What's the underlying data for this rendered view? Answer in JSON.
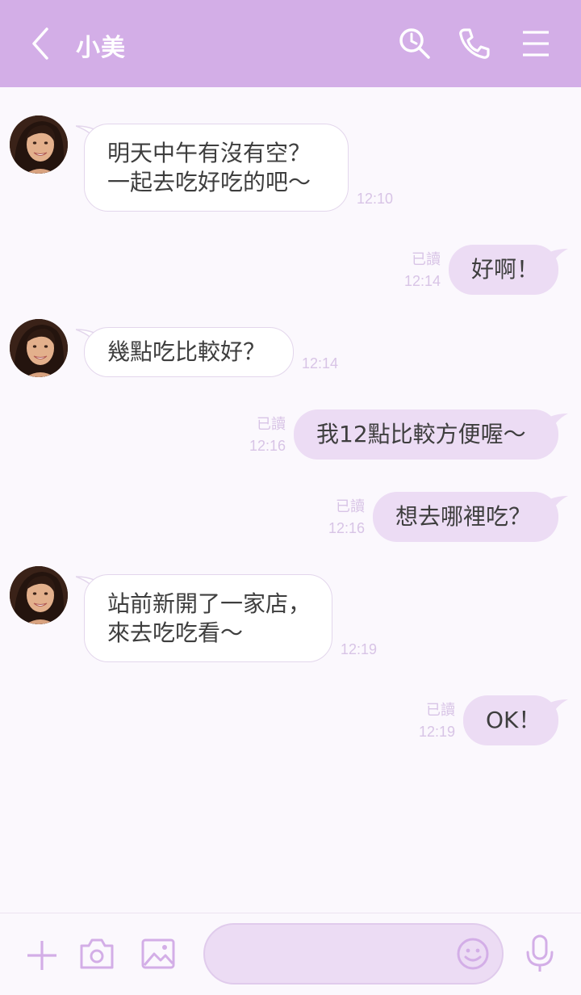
{
  "header": {
    "title": "小美",
    "icons": [
      "back-icon",
      "search-icon",
      "phone-icon",
      "menu-icon"
    ]
  },
  "colors": {
    "header_bg": "#d3aee7",
    "outgoing_bubble": "#ecdcf4",
    "incoming_bubble": "#ffffff",
    "meta_text": "#d8c4e6",
    "icon_accent": "#d3aee7"
  },
  "messages": [
    {
      "dir": "in",
      "lines": [
        "明天中午有沒有空？",
        "一起去吃好吃的吧〜"
      ],
      "time": "12:10"
    },
    {
      "dir": "out",
      "lines": [
        "好啊！"
      ],
      "read": "已讀",
      "time": "12:14"
    },
    {
      "dir": "in",
      "lines": [
        "幾點吃比較好？"
      ],
      "time": "12:14"
    },
    {
      "dir": "out",
      "lines": [
        "我12點比較方便喔〜"
      ],
      "read": "已讀",
      "time": "12:16"
    },
    {
      "dir": "out",
      "lines": [
        "想去哪裡吃？"
      ],
      "read": "已讀",
      "time": "12:16"
    },
    {
      "dir": "in",
      "lines": [
        "站前新開了一家店，",
        "來去吃吃看〜"
      ],
      "time": "12:19"
    },
    {
      "dir": "out",
      "lines": [
        "OK！"
      ],
      "read": "已讀",
      "time": "12:19"
    }
  ],
  "footer": {
    "icons": [
      "plus-icon",
      "camera-icon",
      "image-icon",
      "emoji-icon",
      "mic-icon"
    ],
    "input_value": "",
    "input_placeholder": ""
  }
}
